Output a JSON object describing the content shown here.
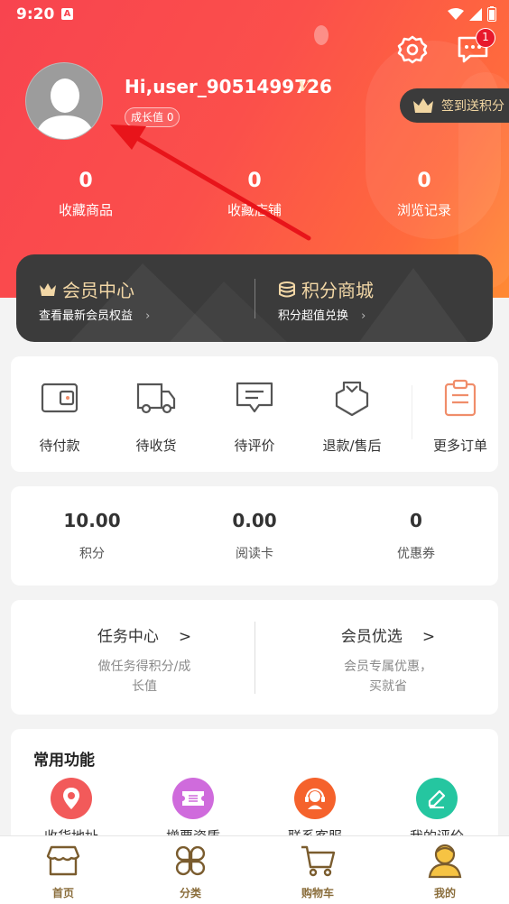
{
  "status_bar": {
    "time": "9:20",
    "app_badge": "A"
  },
  "header": {
    "message_badge_count": "1",
    "username": "Hi,user_9051499726",
    "vip_label": "V",
    "growth_label": "成长值 0",
    "checkin_label": "签到送积分",
    "stats": [
      {
        "value": "0",
        "label": "收藏商品"
      },
      {
        "value": "0",
        "label": "收藏店铺"
      },
      {
        "value": "0",
        "label": "浏览记录"
      }
    ]
  },
  "member_card": {
    "left": {
      "title": "会员中心",
      "subtitle": "查看最新会员权益",
      "icon": "crown-icon"
    },
    "right": {
      "title": "积分商城",
      "subtitle": "积分超值兑换",
      "icon": "coins-icon"
    }
  },
  "orders": [
    {
      "label": "待付款",
      "icon": "wallet-icon"
    },
    {
      "label": "待收货",
      "icon": "truck-icon"
    },
    {
      "label": "待评价",
      "icon": "comment-icon"
    },
    {
      "label": "退款/售后",
      "icon": "refund-icon"
    },
    {
      "label": "更多订单",
      "icon": "clipboard-icon"
    }
  ],
  "assets": [
    {
      "value": "10.00",
      "label": "积分"
    },
    {
      "value": "0.00",
      "label": "阅读卡"
    },
    {
      "value": "0",
      "label": "优惠券"
    }
  ],
  "tasks": [
    {
      "title": "任务中心",
      "arrow": ">",
      "desc_line1": "做任务得积分/成",
      "desc_line2": "长值"
    },
    {
      "title": "会员优选",
      "arrow": ">",
      "desc_line1": "会员专属优惠，",
      "desc_line2": "买就省"
    }
  ],
  "functions": {
    "title": "常用功能",
    "items": [
      {
        "label": "收货地址",
        "icon": "location-icon",
        "color": "#f25a5a"
      },
      {
        "label": "增票资质",
        "icon": "ticket-icon",
        "color": "#cf6bdc"
      },
      {
        "label": "联系客服",
        "icon": "service-icon",
        "color": "#f5622c"
      },
      {
        "label": "我的评价",
        "icon": "edit-icon",
        "color": "#25c6a0"
      }
    ]
  },
  "tabbar": [
    {
      "label": "首页",
      "icon": "home-icon"
    },
    {
      "label": "分类",
      "icon": "category-icon"
    },
    {
      "label": "购物车",
      "icon": "cart-icon"
    },
    {
      "label": "我的",
      "icon": "user-icon"
    }
  ],
  "colors": {
    "accent": "#f8444f",
    "gold": "#f2d7a6",
    "tab_text": "#8a6d3b",
    "annotation_arrow": "#e8141a"
  }
}
